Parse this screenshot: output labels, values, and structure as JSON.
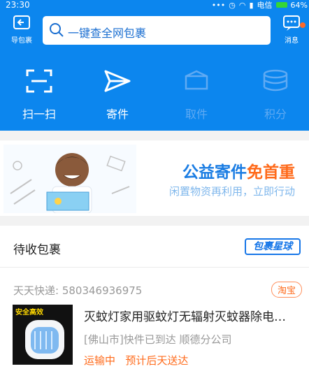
{
  "status_bar": {
    "time": "23:30",
    "icons": [
      "...",
      "alarm-icon",
      "wifi-icon",
      "signal-icon"
    ],
    "carrier": "电信",
    "battery": "64%"
  },
  "header": {
    "import_label": "导包裹",
    "search_placeholder": "一键查全网包裹",
    "message_label": "消息",
    "functions": [
      {
        "label": "扫一扫",
        "icon": "scan-icon",
        "enabled": true
      },
      {
        "label": "寄件",
        "icon": "paper-plane-icon",
        "enabled": true
      },
      {
        "label": "取件",
        "icon": "box-icon",
        "enabled": false
      },
      {
        "label": "积分",
        "icon": "coins-icon",
        "enabled": false
      }
    ]
  },
  "banner": {
    "title_a": "公益寄件",
    "title_b": "免首重",
    "subtitle": "闲置物资再利用，立即行动"
  },
  "pending": {
    "title": "待收包裹",
    "logo": "包裹星球",
    "package": {
      "tracking": "天天快递: 580346936975",
      "source": "淘宝",
      "thumb_tag": "安全高效",
      "product": "灭蚊灯家用驱蚊灯无辐射灭蚊器除电…",
      "location": "[佛山市]快件已到达 顺德分公司",
      "status": "运输中",
      "eta": "预计后天送达"
    }
  }
}
